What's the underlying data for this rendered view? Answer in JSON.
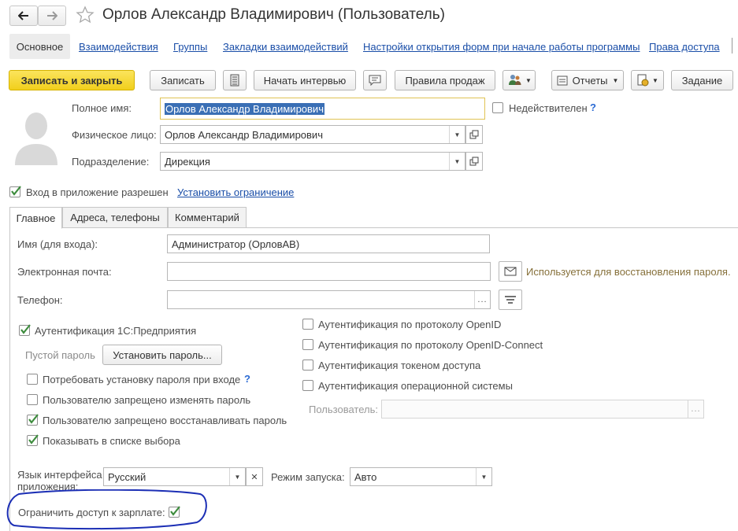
{
  "window": {
    "title": "Орлов Александр Владимирович (Пользователь)"
  },
  "nav": {
    "tabs": [
      {
        "label": "Основное",
        "active": true
      },
      {
        "label": "Взаимодействия"
      },
      {
        "label": "Группы"
      },
      {
        "label": "Закладки взаимодействий"
      },
      {
        "label": "Настройки открытия форм при начале работы программы"
      },
      {
        "label": "Права доступа"
      }
    ]
  },
  "toolbar": {
    "save_close_label": "Записать и закрыть",
    "save_label": "Записать",
    "start_interview_label": "Начать интервью",
    "sales_rules_label": "Правила продаж",
    "reports_label": "Отчеты",
    "task_label": "Задание"
  },
  "header": {
    "full_name_label": "Полное имя:",
    "full_name_value": "Орлов Александр Владимирович",
    "invalid_label": "Недействителен",
    "help_mark": "?",
    "person_label": "Физическое лицо:",
    "person_value": "Орлов Александр Владимирович",
    "department_label": "Подразделение:",
    "department_value": "Дирекция",
    "login_allowed_label": "Вход в приложение разрешен",
    "set_restriction_link": "Установить ограничение"
  },
  "tabs": [
    {
      "label": "Главное",
      "active": true
    },
    {
      "label": "Адреса, телефоны"
    },
    {
      "label": "Комментарий"
    }
  ],
  "main": {
    "login_name_label": "Имя (для входа):",
    "login_name_value": "Администратор (ОрловАВ)",
    "email_label": "Электронная почта:",
    "email_value": "",
    "email_hint": "Используется для восстановления пароля.",
    "phone_label": "Телефон:",
    "phone_value": "",
    "auth_1c_label": "Аутентификация 1С:Предприятия",
    "empty_password_label": "Пустой пароль",
    "set_password_label": "Установить пароль...",
    "require_password_label": "Потребовать установку пароля при входе",
    "forbid_change_password_label": "Пользователю запрещено изменять пароль",
    "forbid_restore_password_label": "Пользователю запрещено восстанавливать пароль",
    "show_in_list_label": "Показывать в списке выбора",
    "auth_openid_label": "Аутентификация по протоколу OpenID",
    "auth_openid_connect_label": "Аутентификация по протоколу OpenID-Connect",
    "auth_token_label": "Аутентификация токеном доступа",
    "auth_os_label": "Аутентификация операционной системы",
    "os_user_label": "Пользователь:",
    "os_user_value": "",
    "language_label_line1": "Язык интерфейса",
    "language_label_line2": "приложения:",
    "language_value": "Русский",
    "launch_mode_label": "Режим запуска:",
    "launch_mode_value": "Авто",
    "salary_restriction_label": "Ограничить доступ к зарплате:"
  },
  "colors": {
    "primary_button": "#f5d326",
    "link": "#1a4ea8",
    "checkmark": "#3d8c3d",
    "annotation_ellipse": "#1c2fb5",
    "hint_text": "#86703a"
  }
}
